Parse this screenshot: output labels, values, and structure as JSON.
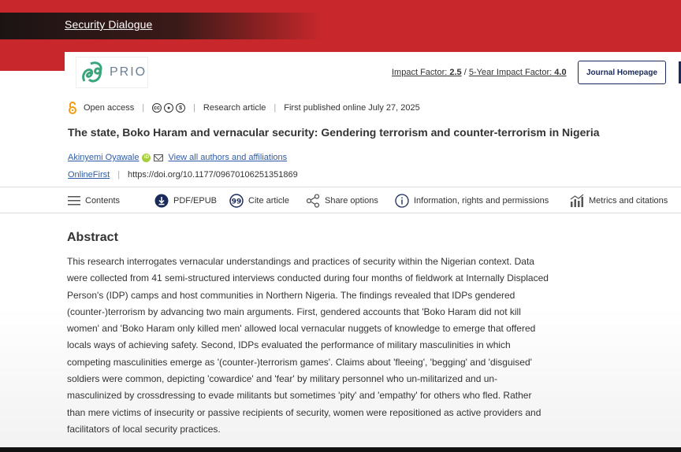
{
  "journal": {
    "name": "Security Dialogue"
  },
  "header": {
    "logo_text": "PRIO",
    "impact_factor_label": "Impact Factor:",
    "impact_factor_value": "2.5",
    "impact_sep": "/",
    "five_year_label": "5-Year Impact Factor:",
    "five_year_value": "4.0",
    "journal_homepage_label": "Journal Homepage"
  },
  "meta": {
    "open_access": "Open access",
    "article_type": "Research article",
    "published": "First published online July 27, 2025"
  },
  "article": {
    "title": "The state, Boko Haram and vernacular security: Gendering terrorism and counter-terrorism in Nigeria",
    "author": "Akinyemi Oyawale",
    "view_all": "View all authors and affiliations",
    "section": "OnlineFirst",
    "doi": "https://doi.org/10.1177/09670106251351869"
  },
  "toolbar": {
    "contents": "Contents",
    "pdf": "PDF/EPUB",
    "cite": "Cite article",
    "share": "Share options",
    "info": "Information, rights and permissions",
    "metrics": "Metrics and citations"
  },
  "abstract": {
    "heading": "Abstract",
    "text": "This research interrogates vernacular understandings and practices of security within the Nigerian context. Data were collected from 41 semi-structured interviews conducted during four months of fieldwork at Internally Displaced Person's (IDP) camps and host communities in Northern Nigeria. The findings revealed that IDPs gendered (counter-)terrorism by advancing two main arguments. First, gendered accounts that 'Boko Haram did not kill women' and 'Boko Haram only killed men' allowed local vernacular nuggets of knowledge to emerge that offered locals ways of achieving safety. Second, IDPs evaluated the performance of military masculinities in which competing masculinities emerge as '(counter-)terrorism games'. Claims about 'fleeing', 'begging' and 'disguised' soldiers were common, depicting 'cowardice' and 'fear' by military personnel who un-militarized and un-masculinized by crossdressing to evade militants but sometimes 'pity' and 'empathy' for others who fled. Rather than mere victims of insecurity or passive recipients of security, women were repositioned as active providers and facilitators of local security practices."
  },
  "colors": {
    "brand_red": "#c8282c",
    "link_blue": "#2f5ca8",
    "navy": "#1a2a5a",
    "oa_orange": "#f39c12"
  }
}
